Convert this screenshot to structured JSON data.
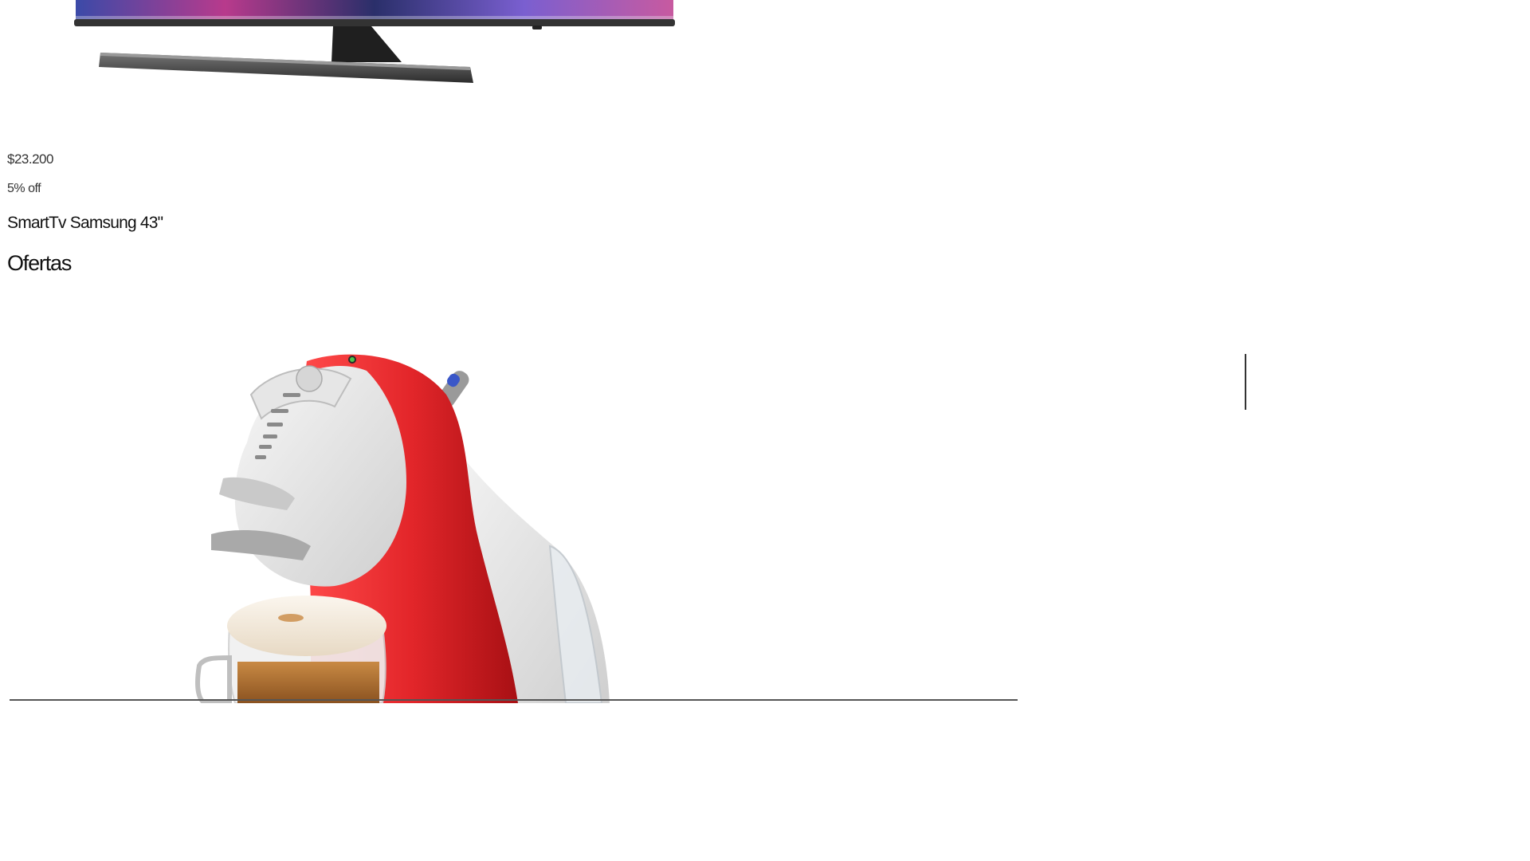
{
  "product": {
    "price": "$23.200",
    "discount": "5% off",
    "title": "SmartTv Samsung 43\"",
    "image_icon": "tv-product-image"
  },
  "section": {
    "title": "Ofertas"
  },
  "next_product": {
    "image_icon": "coffee-machine-product-image"
  },
  "colors": {
    "accent_red": "#e3262a",
    "text": "#222222",
    "background": "#ffffff"
  }
}
